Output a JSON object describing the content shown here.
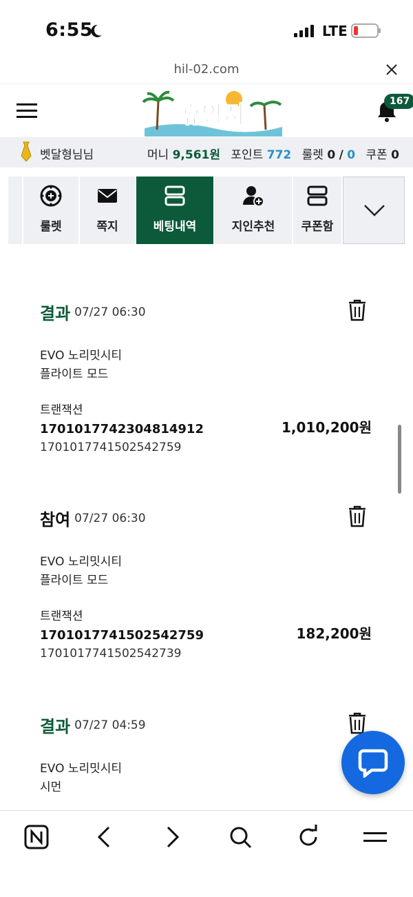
{
  "status_bar": {
    "time": "6:55",
    "network": "LTE"
  },
  "browser": {
    "url": "hil-02.com"
  },
  "header": {
    "notification_count": "167",
    "logo_text": "휴양지"
  },
  "user_bar": {
    "username": "벳달형님님",
    "money_label": "머니",
    "money_value": "9,561원",
    "point_label": "포인트",
    "point_value": "772",
    "roulette_label": "룰렛",
    "roulette_used": "0",
    "roulette_sep": "/",
    "roulette_total": "0",
    "coupon_label": "쿠폰",
    "coupon_value": "0"
  },
  "menu": [
    {
      "label": "룰렛",
      "icon": "roulette-icon"
    },
    {
      "label": "쪽지",
      "icon": "envelope-icon"
    },
    {
      "label": "베팅내역",
      "icon": "list-icon",
      "active": true
    },
    {
      "label": "지인추천",
      "icon": "add-user-icon"
    },
    {
      "label": "쿠폰함",
      "icon": "list-icon"
    }
  ],
  "bets": [
    {
      "status": "결과",
      "time": "07/27 06:30",
      "game": "EVO 노리밋시티",
      "mode": "플라이트 모드",
      "tx_label": "트랜잭션",
      "tx_id": "1701017742304814912",
      "tx_ref": "1701017741502542759",
      "amount": "1,010,200원"
    },
    {
      "status": "참여",
      "time": "07/27 06:30",
      "game": "EVO 노리밋시티",
      "mode": "플라이트 모드",
      "tx_label": "트랜잭션",
      "tx_id": "1701017741502542759",
      "tx_ref": "1701017741502542739",
      "amount": "182,200원"
    },
    {
      "status": "결과",
      "time": "07/27 04:59",
      "game": "EVO 노리밋시티",
      "mode": "시먼"
    }
  ],
  "colors": {
    "brand_green": "#0c5a3a",
    "accent_blue": "#2a8fc6",
    "chat_blue": "#1469e0",
    "bar_bg": "#eef0f4"
  }
}
